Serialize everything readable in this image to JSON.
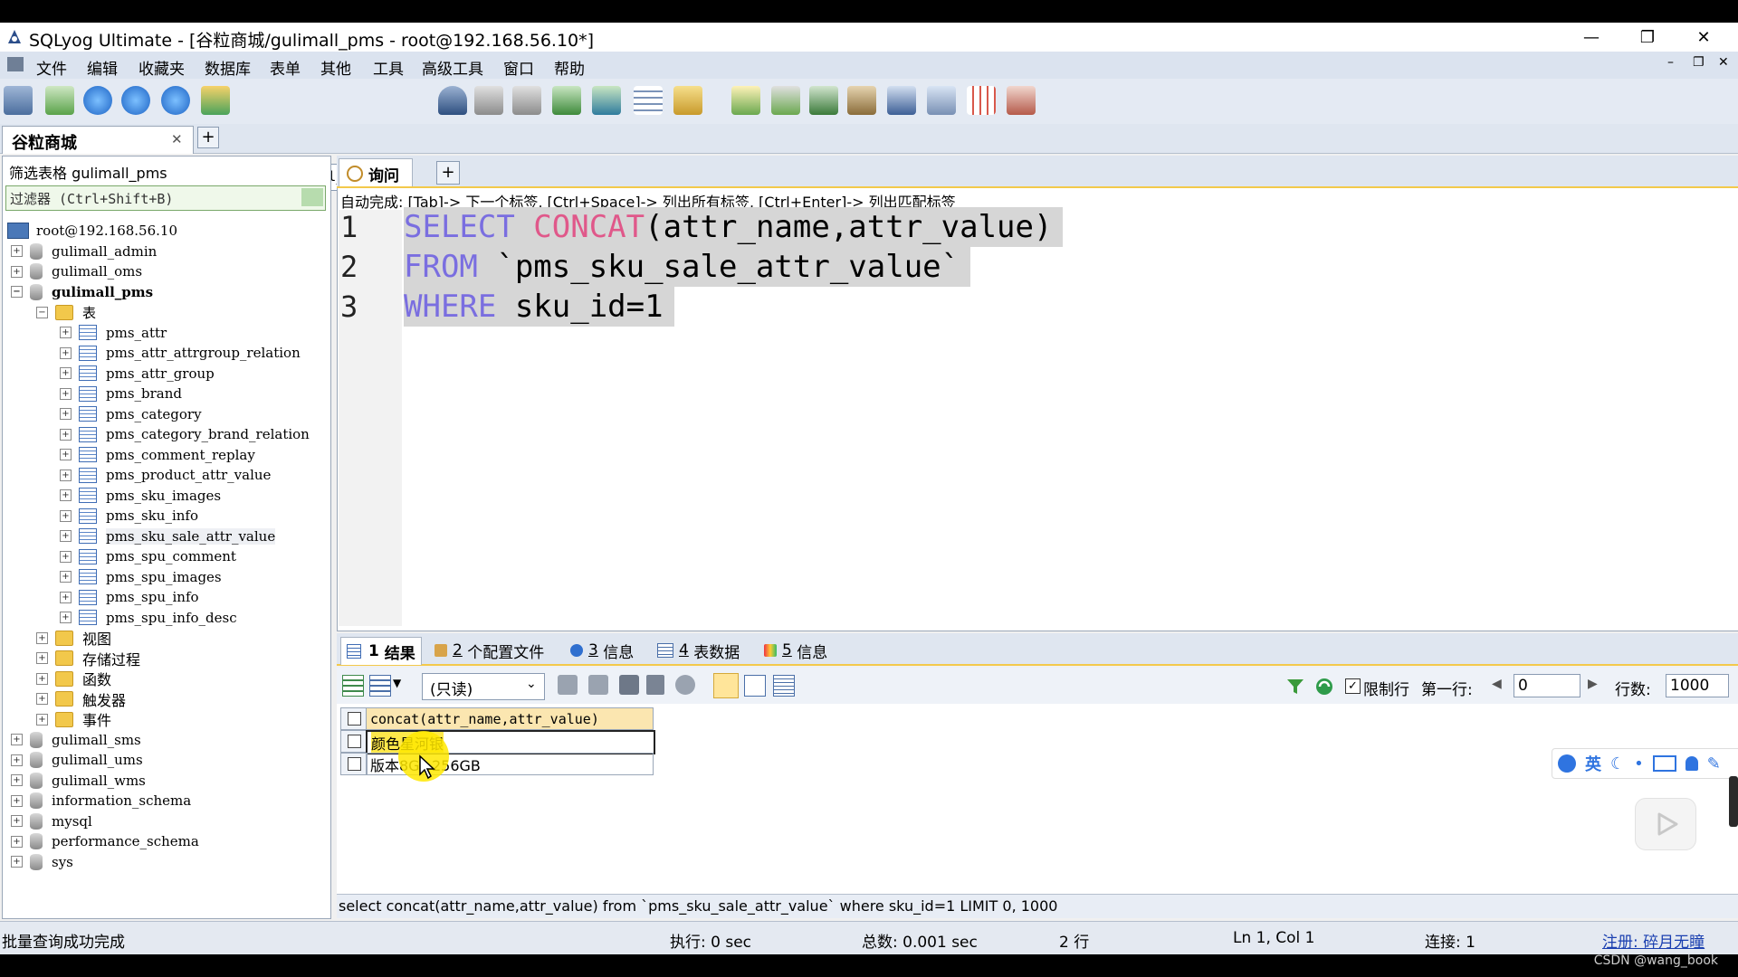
{
  "window": {
    "title": "SQLyog Ultimate - [谷粒商城/gulimall_pms - root@192.168.56.10*]",
    "controls": [
      "—",
      "❐",
      "✕"
    ],
    "inner_controls": [
      "–",
      "❐",
      "✕"
    ]
  },
  "menu": [
    "文件",
    "编辑",
    "收藏夹",
    "数据库",
    "表单",
    "其他",
    "工具",
    "高级工具",
    "窗口",
    "帮助"
  ],
  "toolbar": {
    "database_select": "gulimall_pms"
  },
  "connection_tab": {
    "label": "谷粒商城",
    "close": "✕",
    "add": "+"
  },
  "left": {
    "filter_label": "筛选表格 gulimall_pms",
    "filter_placeholder": "过滤器 (Ctrl+Shift+B)",
    "server": "root@192.168.56.10",
    "databases_top": [
      "gulimall_admin",
      "gulimall_oms"
    ],
    "current_db": "gulimall_pms",
    "tables_folder": "表",
    "tables": [
      "pms_attr",
      "pms_attr_attrgroup_relation",
      "pms_attr_group",
      "pms_brand",
      "pms_category",
      "pms_category_brand_relation",
      "pms_comment_replay",
      "pms_product_attr_value",
      "pms_sku_images",
      "pms_sku_info",
      "pms_sku_sale_attr_value",
      "pms_spu_comment",
      "pms_spu_images",
      "pms_spu_info",
      "pms_spu_info_desc"
    ],
    "folders": [
      "视图",
      "存储过程",
      "函数",
      "触发器",
      "事件"
    ],
    "databases_bottom": [
      "gulimall_sms",
      "gulimall_ums",
      "gulimall_wms",
      "information_schema",
      "mysql",
      "performance_schema",
      "sys"
    ]
  },
  "editor": {
    "tab_label": "询问",
    "add": "+",
    "autocomplete": "自动完成: [Tab]-> 下一个标签, [Ctrl+Space]-> 列出所有标签, [Ctrl+Enter]-> 列出匹配标签",
    "line_numbers": [
      "1",
      "2",
      "3"
    ],
    "lines": [
      [
        {
          "t": "SELECT ",
          "c": "kw"
        },
        {
          "t": "CONCAT",
          "c": "fn"
        },
        {
          "t": "(attr_name,attr_value)",
          "c": ""
        }
      ],
      [
        {
          "t": "FROM ",
          "c": "kw"
        },
        {
          "t": "`pms_sku_sale_attr_value`",
          "c": ""
        }
      ],
      [
        {
          "t": "WHERE ",
          "c": "kw"
        },
        {
          "t": "sku_id=1",
          "c": ""
        }
      ]
    ]
  },
  "results": {
    "tabs": [
      {
        "num": "1",
        "label": "结果"
      },
      {
        "num": "2",
        "label": "个配置文件"
      },
      {
        "num": "3",
        "label": "信息"
      },
      {
        "num": "4",
        "label": "表数据"
      },
      {
        "num": "5",
        "label": "信息"
      }
    ],
    "readonly": "(只读)",
    "limit_label": "限制行",
    "first_row_label": "第一行:",
    "first_row_value": "0",
    "rows_label": "行数:",
    "rows_value": "1000",
    "column": "concat(attr_name,attr_value)",
    "rows": [
      "颜色星河银",
      "版本8G+256GB"
    ],
    "sql": "select concat(attr_name,attr_value) from `pms_sku_sale_attr_value` where sku_id=1 LIMIT 0, 1000"
  },
  "ime": {
    "label": "英"
  },
  "status": {
    "message": "批量查询成功完成",
    "exec": "执行: 0 sec",
    "total": "总数: 0.001 sec",
    "rows": "2 行",
    "pos": "Ln 1, Col 1",
    "conn": "连接: 1",
    "register": "注册: 碎月无瞳"
  },
  "watermark": "CSDN @wang_book",
  "colors": {
    "keyword": "#7a6ee0",
    "function": "#e0588a",
    "tab_accent": "#f3c94b",
    "link": "#1a3fb0"
  }
}
